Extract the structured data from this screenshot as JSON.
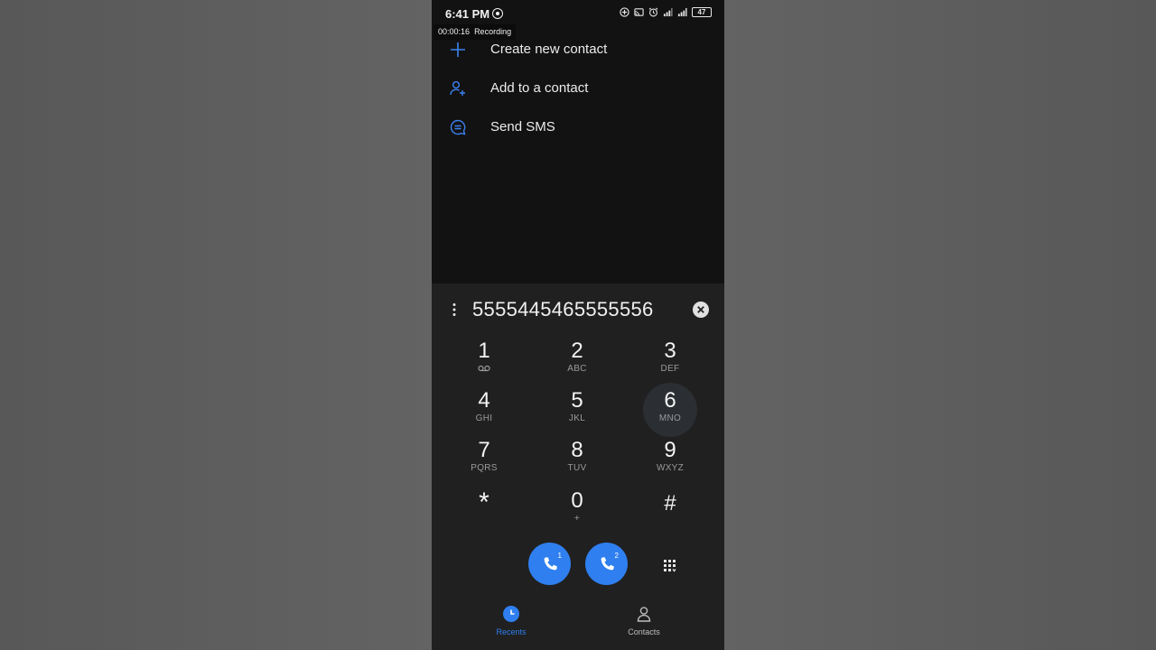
{
  "status_bar": {
    "time": "6:41 PM",
    "battery": "47",
    "recording_timer": "00:00:16",
    "recording_label": "Recording"
  },
  "menu": {
    "items": [
      {
        "label": "Create new contact",
        "icon": "plus-icon"
      },
      {
        "label": "Add to a contact",
        "icon": "person-add-icon"
      },
      {
        "label": "Send SMS",
        "icon": "message-icon"
      }
    ]
  },
  "dialer": {
    "number": "5555445465555556",
    "keys": [
      {
        "digit": "1",
        "letters": ""
      },
      {
        "digit": "2",
        "letters": "ABC"
      },
      {
        "digit": "3",
        "letters": "DEF"
      },
      {
        "digit": "4",
        "letters": "GHI"
      },
      {
        "digit": "5",
        "letters": "JKL"
      },
      {
        "digit": "6",
        "letters": "MNO"
      },
      {
        "digit": "7",
        "letters": "PQRS"
      },
      {
        "digit": "8",
        "letters": "TUV"
      },
      {
        "digit": "9",
        "letters": "WXYZ"
      },
      {
        "digit": "*",
        "letters": ""
      },
      {
        "digit": "0",
        "letters": "+"
      },
      {
        "digit": "#",
        "letters": ""
      }
    ],
    "call_sim1_label": "1",
    "call_sim2_label": "2"
  },
  "nav": {
    "recents_label": "Recents",
    "contacts_label": "Contacts"
  },
  "colors": {
    "accent": "#2f7ff0",
    "background": "#121212",
    "dial_panel": "#202020"
  }
}
